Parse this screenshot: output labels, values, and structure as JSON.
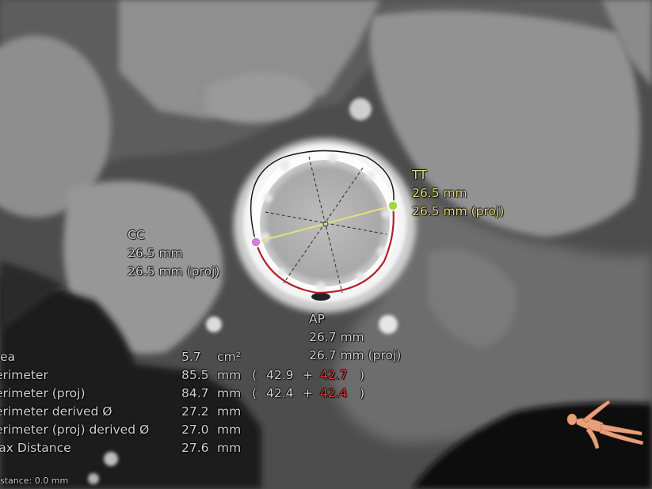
{
  "annotations": {
    "tt": {
      "label": "TT",
      "mm": "26.5 mm",
      "proj": "26.5 mm (proj)"
    },
    "cc": {
      "label": "CC",
      "mm": "26.5 mm",
      "proj": "26.5 mm (proj)"
    },
    "ap": {
      "label": "AP",
      "mm": "26.7 mm",
      "proj": "26.7 mm (proj)"
    }
  },
  "stats": {
    "area": {
      "label": "rea",
      "value": "5.7",
      "unit": "cm²"
    },
    "perimeter": {
      "label": "erimeter",
      "value": "85.5",
      "unit": "mm",
      "open": "(",
      "part1": "42.9",
      "plus": "+",
      "part2": "42.7",
      "close": ")"
    },
    "perimeter_proj": {
      "label": "erimeter (proj)",
      "value": "84.7",
      "unit": "mm",
      "open": "(",
      "part1": "42.4",
      "plus": "+",
      "part2": "42.4",
      "close": ")"
    },
    "perimeter_derived": {
      "label": "erimeter derived Ø",
      "value": "27.2",
      "unit": "mm"
    },
    "perimeter_proj_derived": {
      "label": "erimeter (proj) derived Ø",
      "value": "27.0",
      "unit": "mm"
    },
    "max_distance": {
      "label": "lax Distance",
      "value": "27.6",
      "unit": "mm"
    }
  },
  "footer": {
    "distance": "stance: 0.0 mm"
  },
  "icons": {
    "orientation": "patient-orientation-figure-icon"
  },
  "colors": {
    "measure_yellow": "#e3e07a",
    "highlight_red": "#e83a3a",
    "arc_red": "#b2202a",
    "text_gray": "#d2d2d2",
    "handle_pink": "#d07fd8",
    "handle_green": "#9fd93e"
  }
}
